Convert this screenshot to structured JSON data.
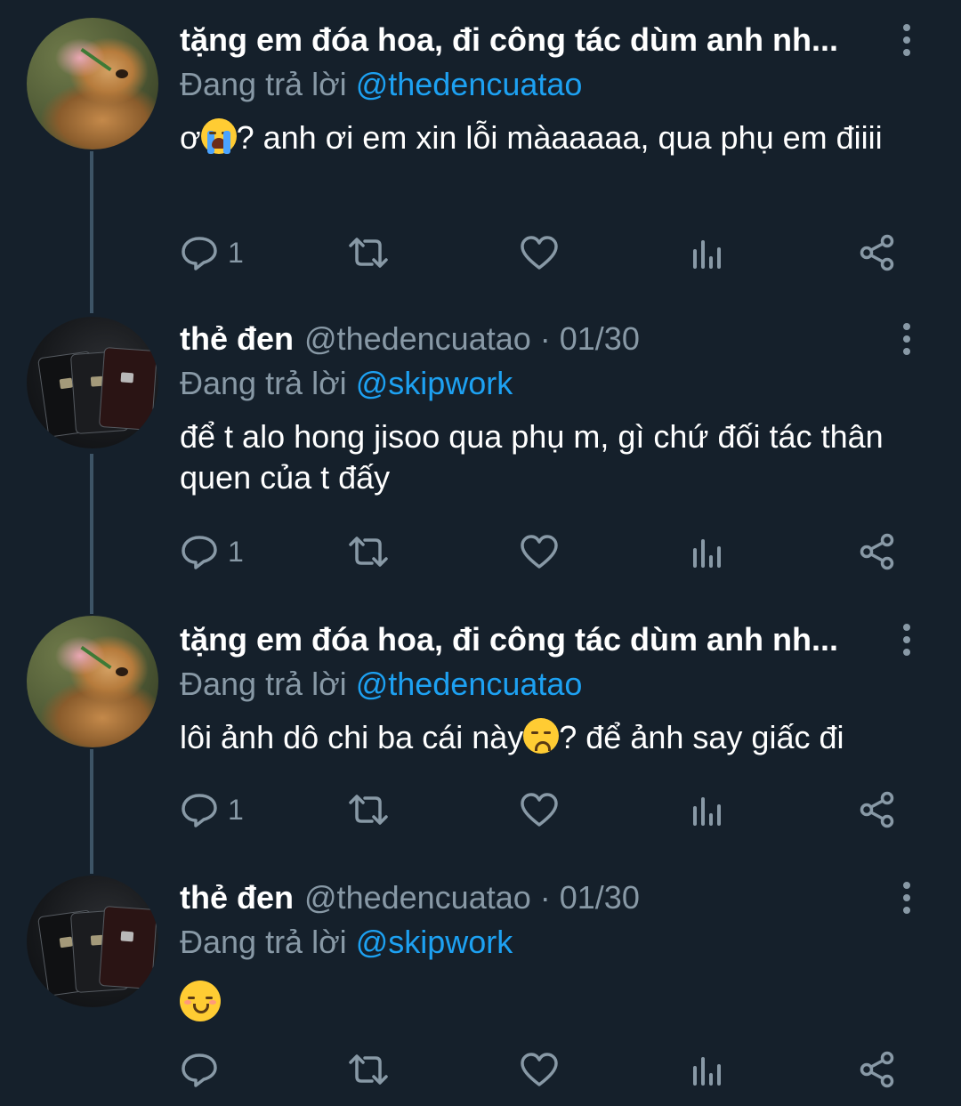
{
  "tweets": [
    {
      "name": "tặng em đóa hoa, đi công tác dùm anh nh...",
      "handle": "",
      "date": "",
      "reply_label": "Đang trả lời",
      "reply_to": "@thedencuatao",
      "text_before": "ơ",
      "emoji": "loudly-crying-face",
      "text_after": "? anh ơi em xin lỗi màaaaaa, qua phụ em điiii",
      "reply_count": "1"
    },
    {
      "name": "thẻ đen",
      "handle": "@thedencuatao",
      "date": "01/30",
      "reply_label": "Đang trả lời",
      "reply_to": "@skipwork",
      "text_before": "để t alo hong jisoo qua phụ m, gì chứ đối tác thân quen của t đấy",
      "emoji": "",
      "text_after": "",
      "reply_count": "1"
    },
    {
      "name": "tặng em đóa hoa, đi công tác dùm anh nh...",
      "handle": "",
      "date": "",
      "reply_label": "Đang trả lời",
      "reply_to": "@thedencuatao",
      "text_before": "lôi ảnh dô chi ba cái này",
      "emoji": "disappointed-face",
      "text_after": "? để ảnh say giấc đi",
      "reply_count": "1"
    },
    {
      "name": "thẻ đen",
      "handle": "@thedencuatao",
      "date": "01/30",
      "reply_label": "Đang trả lời",
      "reply_to": "@skipwork",
      "text_before": "",
      "emoji": "relieved-face",
      "text_after": "",
      "reply_count": ""
    }
  ],
  "separator": "·",
  "colors": {
    "background": "#15202b",
    "muted": "#8899a6",
    "link": "#1da1f2",
    "thread_line": "#3d5466"
  }
}
